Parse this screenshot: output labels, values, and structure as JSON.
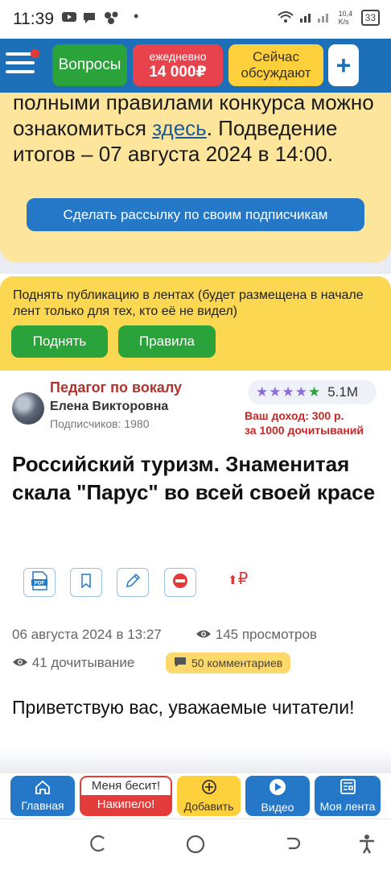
{
  "status_bar": {
    "time": "11:39",
    "network_speed": "10,4 K/s",
    "battery": "33"
  },
  "header": {
    "questions_label": "Вопросы",
    "daily_label": "ежедневно",
    "daily_amount": "14 000₽",
    "discussing_label": "Сейчас обсуждают",
    "plus_label": "+"
  },
  "contest": {
    "text_before": "полными правилами конкурса можно ознакомиться ",
    "link_text": "здесь",
    "text_after": ". Подведение итогов – 07 августа 2024 в 14:00.",
    "mailing_button": "Сделать рассылку по своим подписчикам"
  },
  "boost": {
    "text": "Поднять публикацию в лентах (будет размещена в начале лент только для тех, кто её не видел)",
    "raise_button": "Поднять",
    "rules_button": "Правила"
  },
  "article": {
    "author_role": "Педагог по вокалу",
    "author_name": "Елена Викторовна",
    "subscribers": "Подписчиков: 1980",
    "rating_value": "5.1M",
    "income_line1": "Ваш доход: 300 р.",
    "income_line2": "за 1000 дочитываний",
    "title": "Российский туризм. Знаменитая скала \"Парус\" во всей своей красе",
    "tools": [
      "pdf-icon",
      "bookmark-icon",
      "edit-icon",
      "block-icon"
    ],
    "raise_symbol": "₽",
    "date": "06 августа 2024 в 13:27",
    "views": "145 просмотров",
    "reads": "41 дочитывание",
    "comments": "50 комментариев",
    "greeting": "Приветствую вас, уважаемые читатели!"
  },
  "bottom_nav": {
    "home": "Главная",
    "annoyed_top": "Меня бесит!",
    "annoyed_bottom": "Накипело!",
    "add": "Добавить",
    "video": "Видео",
    "feed": "Моя лента"
  },
  "colors": {
    "header": "#1d6fb8",
    "green": "#2aa33a",
    "red": "#e8434d",
    "yellow": "#fdd03c",
    "pale_yellow": "#fde69c"
  }
}
